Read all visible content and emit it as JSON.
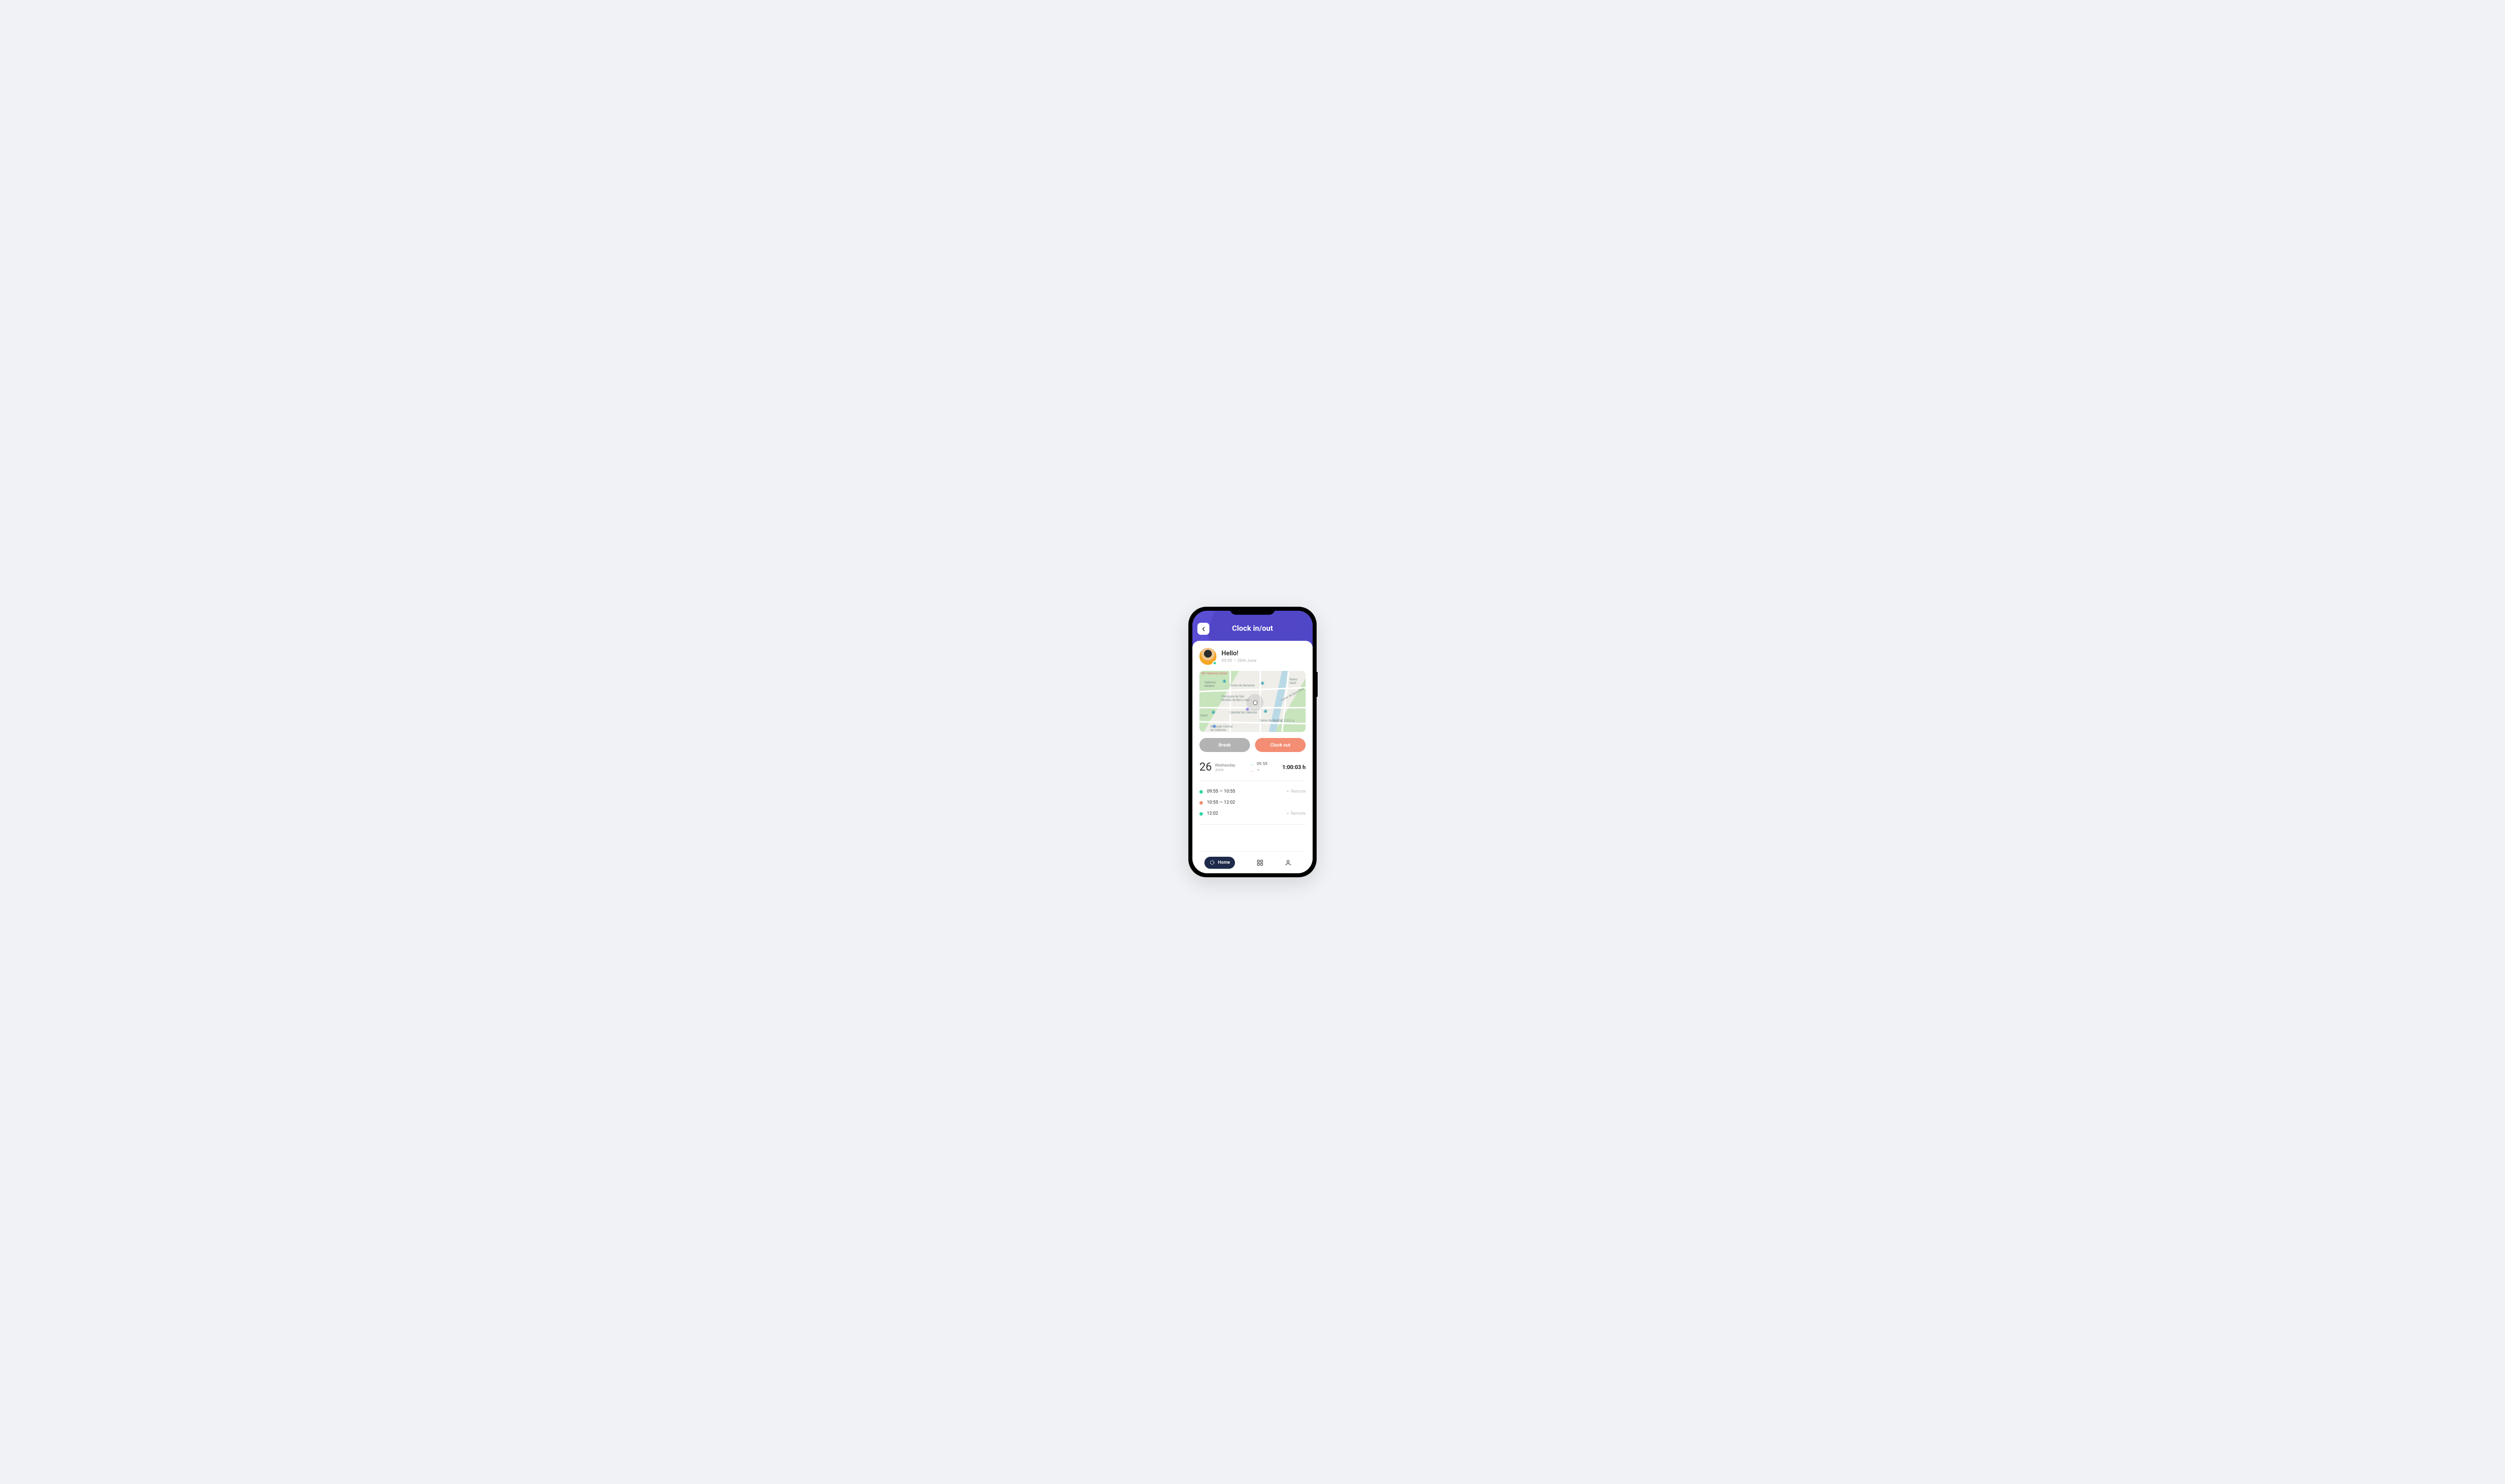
{
  "header": {
    "title": "Clock in/out"
  },
  "greeting": {
    "text": "Hello!",
    "time": "09:55",
    "sep": "—",
    "date": "26th June"
  },
  "map": {
    "labels": {
      "nh": "NH Valencia Center",
      "modern": "València\nModern",
      "torres": "Torres de Serranos",
      "parroquia": "Parroquia de San\nNicolás de Bari y San...",
      "catedral": "Catedral de València",
      "mercado": "Mercado Central\nde València",
      "rearo": "Rearo\nGard",
      "murillo": "Carrer de Murillo",
      "sanpere": "Carrer de Sant Pere",
      "quart": "Quart",
      "xerea": "LA XEREA"
    }
  },
  "buttons": {
    "break": "Break",
    "clockout": "Clock out"
  },
  "summary": {
    "day": "26",
    "dow": "Wednesday",
    "month": "June",
    "in_time": "09.55",
    "out_time": "—",
    "total": "1:00:03 h"
  },
  "entries": [
    {
      "color": "green",
      "range": "09:55 — 10:55",
      "location": "Remote"
    },
    {
      "color": "orange",
      "range": "10:55 — 12:02",
      "location": ""
    },
    {
      "color": "green",
      "range": "12:02",
      "location": "Remote"
    }
  ],
  "nav": {
    "home": "Home"
  }
}
